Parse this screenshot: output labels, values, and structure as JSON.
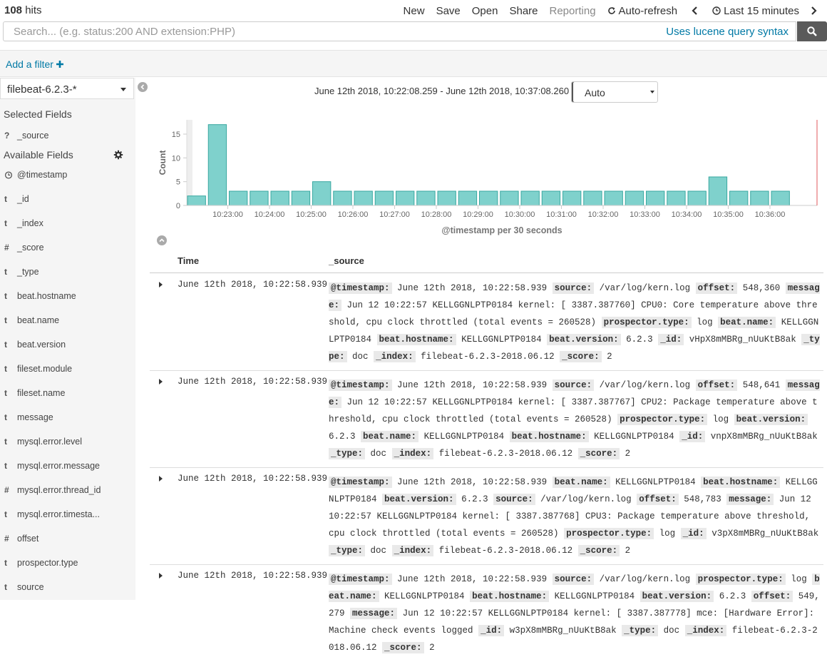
{
  "top": {
    "hits_count": "108",
    "hits_label": " hits",
    "menu": [
      "New",
      "Save",
      "Open",
      "Share"
    ],
    "reporting": "Reporting",
    "autorefresh": "Auto-refresh",
    "time_picker": "Last 15 minutes"
  },
  "search": {
    "placeholder": "Search... (e.g. status:200 AND extension:PHP)",
    "lucene": "Uses lucene query syntax"
  },
  "filter": {
    "add_label": "Add a filter"
  },
  "sidebar": {
    "index_pattern": "filebeat-6.2.3-*",
    "selected_title": "Selected Fields",
    "selected": [
      {
        "type": "?",
        "name": "_source"
      }
    ],
    "available_title": "Available Fields",
    "fields": [
      {
        "type": "clock",
        "name": "@timestamp"
      },
      {
        "type": "t",
        "name": "_id"
      },
      {
        "type": "t",
        "name": "_index"
      },
      {
        "type": "#",
        "name": "_score"
      },
      {
        "type": "t",
        "name": "_type"
      },
      {
        "type": "t",
        "name": "beat.hostname"
      },
      {
        "type": "t",
        "name": "beat.name"
      },
      {
        "type": "t",
        "name": "beat.version"
      },
      {
        "type": "t",
        "name": "fileset.module"
      },
      {
        "type": "t",
        "name": "fileset.name"
      },
      {
        "type": "t",
        "name": "message"
      },
      {
        "type": "t",
        "name": "mysql.error.level"
      },
      {
        "type": "t",
        "name": "mysql.error.message"
      },
      {
        "type": "#",
        "name": "mysql.error.thread_id"
      },
      {
        "type": "t",
        "name": "mysql.error.timesta..."
      },
      {
        "type": "#",
        "name": "offset"
      },
      {
        "type": "t",
        "name": "prospector.type"
      },
      {
        "type": "t",
        "name": "source"
      }
    ]
  },
  "time_range": "June 12th 2018, 10:22:08.259 - June 12th 2018, 10:37:08.260 —",
  "interval": "Auto",
  "chart_data": {
    "type": "bar",
    "xlabel": "@timestamp per 30 seconds",
    "ylabel": "Count",
    "yticks": [
      0,
      5,
      10,
      15
    ],
    "ylim": [
      0,
      18
    ],
    "xticks": [
      "10:23:00",
      "10:24:00",
      "10:25:00",
      "10:26:00",
      "10:27:00",
      "10:28:00",
      "10:29:00",
      "10:30:00",
      "10:31:00",
      "10:32:00",
      "10:33:00",
      "10:34:00",
      "10:35:00",
      "10:36:00"
    ],
    "values": [
      2,
      17,
      3,
      3,
      3,
      3,
      5,
      3,
      3,
      3,
      3,
      3,
      3,
      3,
      3,
      3,
      3,
      3,
      3,
      3,
      3,
      3,
      3,
      3,
      3,
      6,
      3,
      3,
      3
    ],
    "bar_color": "#7fd1cc",
    "bar_stroke": "#3aa8a0"
  },
  "table": {
    "col_time": "Time",
    "col_source": "_source",
    "rows": [
      {
        "time": "June 12th 2018, 10:22:58.939",
        "fields": [
          {
            "k": "@timestamp:",
            "v": "June 12th 2018, 10:22:58.939"
          },
          {
            "k": "source:",
            "v": "/var/log/kern.log"
          },
          {
            "k": "offset:",
            "v": "548,360"
          },
          {
            "k": "message:",
            "v": "Jun 12 10:22:57 KELLGGNLPTP0184 kernel: [ 3387.387760] CPU0: Core temperature above threshold, cpu clock throttled (total events = 260528)"
          },
          {
            "k": "prospector.type:",
            "v": "log"
          },
          {
            "k": "beat.name:",
            "v": "KELLGGNLPTP0184"
          },
          {
            "k": "beat.hostname:",
            "v": "KELLGGNLPTP0184"
          },
          {
            "k": "beat.version:",
            "v": "6.2.3"
          },
          {
            "k": "_id:",
            "v": "vHpX8mMBRg_nUuKtB8ak"
          },
          {
            "k": "_type:",
            "v": "doc"
          },
          {
            "k": "_index:",
            "v": "filebeat-6.2.3-2018.06.12"
          },
          {
            "k": "_score:",
            "v": "2"
          }
        ]
      },
      {
        "time": "June 12th 2018, 10:22:58.939",
        "fields": [
          {
            "k": "@timestamp:",
            "v": "June 12th 2018, 10:22:58.939"
          },
          {
            "k": "source:",
            "v": "/var/log/kern.log"
          },
          {
            "k": "offset:",
            "v": "548,641"
          },
          {
            "k": "message:",
            "v": "Jun 12 10:22:57 KELLGGNLPTP0184 kernel: [ 3387.387767] CPU2: Package temperature above threshold, cpu clock throttled (total events = 260528)"
          },
          {
            "k": "prospector.type:",
            "v": "log"
          },
          {
            "k": "beat.version:",
            "v": "6.2.3"
          },
          {
            "k": "beat.name:",
            "v": "KELLGGNLPTP0184"
          },
          {
            "k": "beat.hostname:",
            "v": "KELLGGNLPTP0184"
          },
          {
            "k": "_id:",
            "v": "vnpX8mMBRg_nUuKtB8ak"
          },
          {
            "k": "_type:",
            "v": "doc"
          },
          {
            "k": "_index:",
            "v": "filebeat-6.2.3-2018.06.12"
          },
          {
            "k": "_score:",
            "v": "2"
          }
        ]
      },
      {
        "time": "June 12th 2018, 10:22:58.939",
        "fields": [
          {
            "k": "@timestamp:",
            "v": "June 12th 2018, 10:22:58.939"
          },
          {
            "k": "beat.name:",
            "v": "KELLGGNLPTP0184"
          },
          {
            "k": "beat.hostname:",
            "v": "KELLGGNLPTP0184"
          },
          {
            "k": "beat.version:",
            "v": "6.2.3"
          },
          {
            "k": "source:",
            "v": "/var/log/kern.log"
          },
          {
            "k": "offset:",
            "v": "548,783"
          },
          {
            "k": "message:",
            "v": "Jun 12 10:22:57 KELLGGNLPTP0184 kernel: [ 3387.387768] CPU3: Package temperature above threshold, cpu clock throttled (total events = 260528)"
          },
          {
            "k": "prospector.type:",
            "v": "log"
          },
          {
            "k": "_id:",
            "v": "v3pX8mMBRg_nUuKtB8ak"
          },
          {
            "k": "_type:",
            "v": "doc"
          },
          {
            "k": "_index:",
            "v": "filebeat-6.2.3-2018.06.12"
          },
          {
            "k": "_score:",
            "v": "2"
          }
        ]
      },
      {
        "time": "June 12th 2018, 10:22:58.939",
        "fields": [
          {
            "k": "@timestamp:",
            "v": "June 12th 2018, 10:22:58.939"
          },
          {
            "k": "source:",
            "v": "/var/log/kern.log"
          },
          {
            "k": "prospector.type:",
            "v": "log"
          },
          {
            "k": "beat.name:",
            "v": "KELLGGNLPTP0184"
          },
          {
            "k": "beat.hostname:",
            "v": "KELLGGNLPTP0184"
          },
          {
            "k": "beat.version:",
            "v": "6.2.3"
          },
          {
            "k": "offset:",
            "v": "549,279"
          },
          {
            "k": "message:",
            "v": "Jun 12 10:22:57 KELLGGNLPTP0184 kernel: [ 3387.387778] mce: [Hardware Error]: Machine check events logged"
          },
          {
            "k": "_id:",
            "v": "w3pX8mMBRg_nUuKtB8ak"
          },
          {
            "k": "_type:",
            "v": "doc"
          },
          {
            "k": "_index:",
            "v": "filebeat-6.2.3-2018.06.12"
          },
          {
            "k": "_score:",
            "v": "2"
          }
        ]
      }
    ]
  }
}
